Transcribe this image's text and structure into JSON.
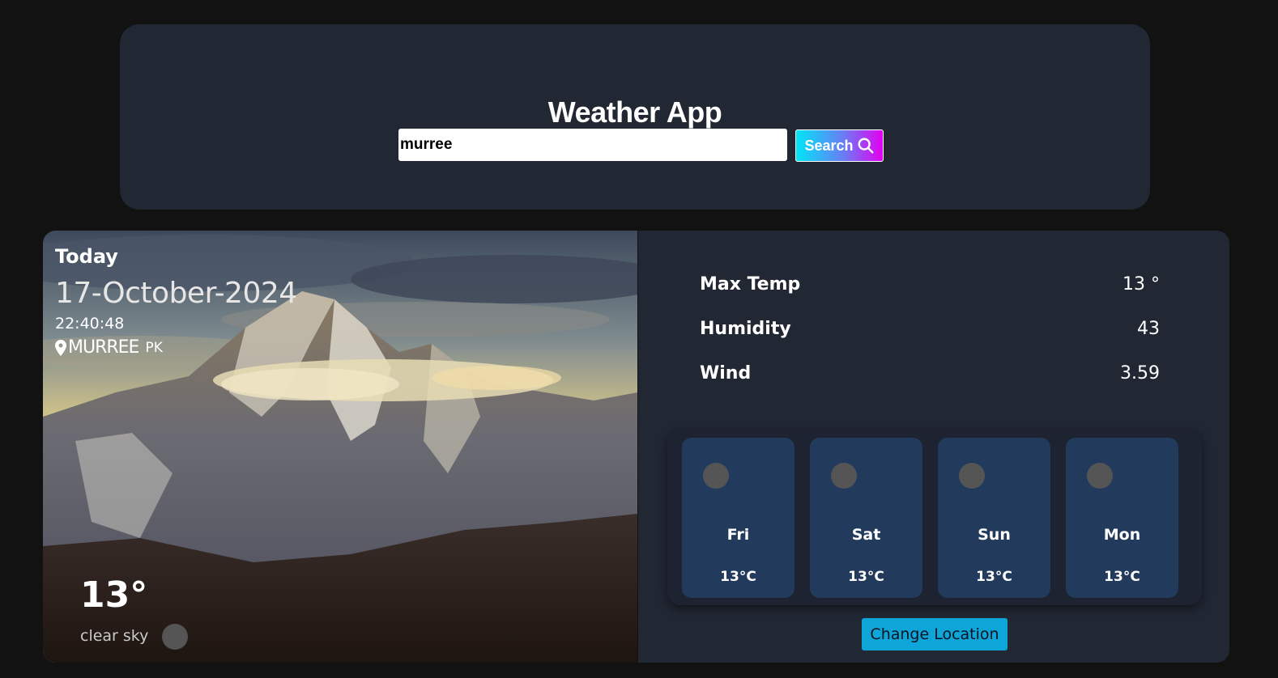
{
  "header": {
    "title": "Weather App",
    "search_value": "murree",
    "search_button_label": "Search"
  },
  "hero": {
    "today_label": "Today",
    "date": "17-October-2024",
    "time": "22:40:48",
    "city": "MURREE",
    "country": "PK",
    "temperature": "13°",
    "description": "clear sky"
  },
  "details": {
    "stats": [
      {
        "label": "Max Temp",
        "value": "13 °"
      },
      {
        "label": "Humidity",
        "value": "43"
      },
      {
        "label": "Wind",
        "value": "3.59"
      }
    ],
    "forecast": [
      {
        "day": "Fri",
        "temp": "13°C"
      },
      {
        "day": "Sat",
        "temp": "13°C"
      },
      {
        "day": "Sun",
        "temp": "13°C"
      },
      {
        "day": "Mon",
        "temp": "13°C"
      }
    ],
    "change_location_label": "Change Location"
  },
  "colors": {
    "background": "#121212",
    "card": "#212733",
    "forecast_card": "#223a5c",
    "accent_button": "#0ea5d9",
    "search_gradient": [
      "#00e6f6",
      "#e400f0"
    ]
  },
  "icons": {
    "search": "search-icon",
    "location": "location-pin-icon",
    "weather": "weather-icon"
  }
}
